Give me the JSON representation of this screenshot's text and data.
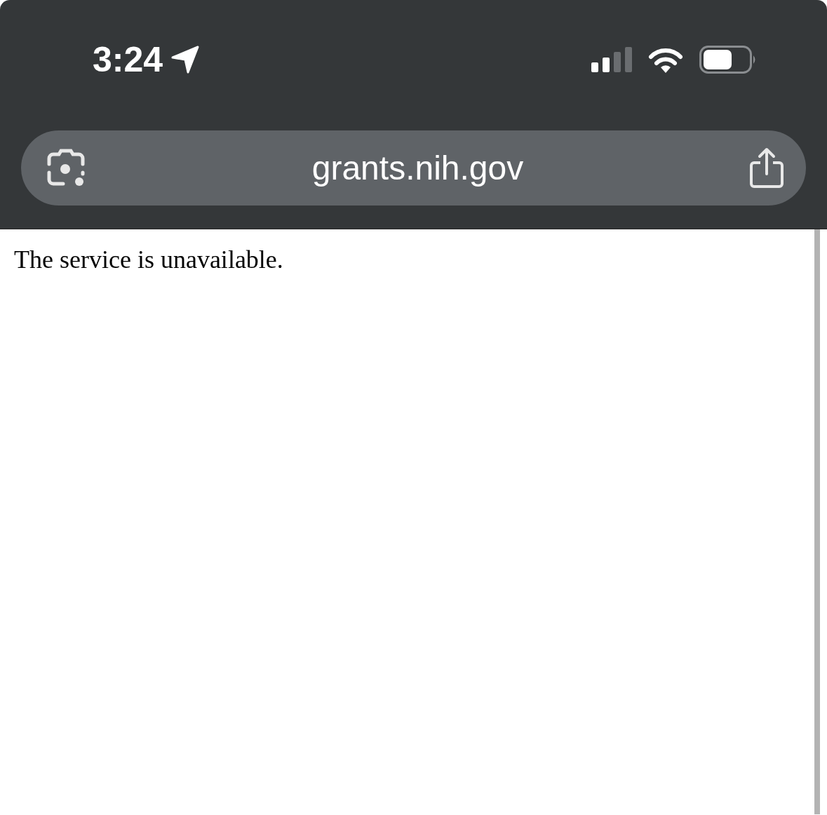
{
  "status_bar": {
    "time": "3:24"
  },
  "address_bar": {
    "url": "grants.nih.gov"
  },
  "page": {
    "message": "The service is unavailable."
  }
}
